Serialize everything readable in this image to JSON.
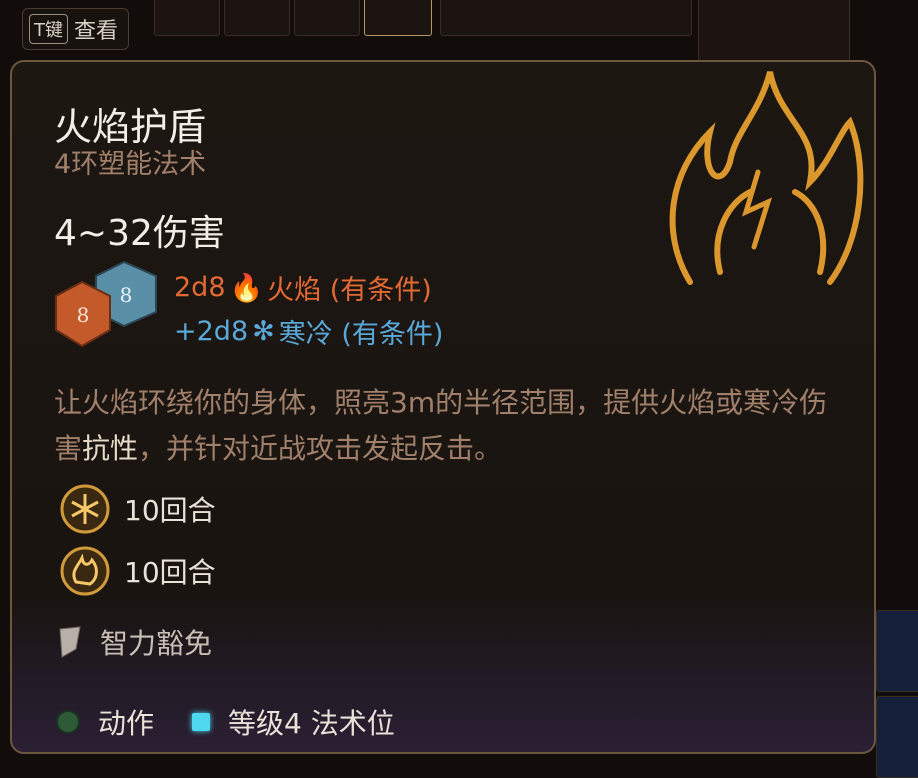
{
  "hint": {
    "key": "T键",
    "label": "查看"
  },
  "spell": {
    "title": "火焰护盾",
    "subtitle": "4环塑能法术",
    "damage": "4~32伤害",
    "dice": {
      "orange": "8",
      "blue": "8"
    },
    "damage_lines": [
      {
        "dice": "2d8",
        "type": "火焰 (有条件)",
        "color": "#e36a32",
        "icon": "fire-icon"
      },
      {
        "dice": "+2d8",
        "type": "寒冷 (有条件)",
        "color": "#5aa8d8",
        "icon": "snowflake-icon"
      }
    ],
    "description_a": "让火焰环绕你的身体，照亮3m的半径范围，提供火焰或寒冷伤害",
    "description_keyword": "抗性",
    "description_b": "，并针对近战攻击发起反击。",
    "durations": [
      {
        "icon": "chill-shield-icon",
        "label": "10回合"
      },
      {
        "icon": "warm-shield-icon",
        "label": "10回合"
      }
    ],
    "save": "智力豁免",
    "cost": {
      "action": "动作",
      "slot": "等级4 法术位"
    }
  },
  "colors": {
    "title": "#f2ede5",
    "subtitle": "#a0806a",
    "fire": "#e36a32",
    "cold": "#5aa8d8",
    "slot": "#4dd8f0"
  }
}
